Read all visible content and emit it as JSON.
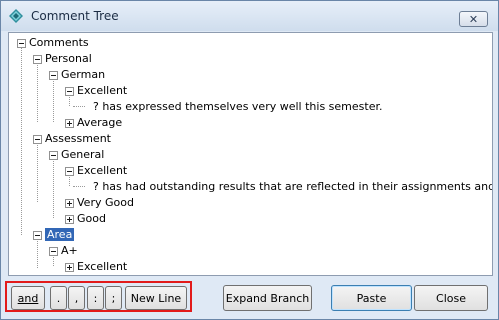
{
  "window": {
    "title": "Comment Tree",
    "close_glyph": "✕"
  },
  "tree": {
    "nodes": [
      {
        "label": "Comments"
      },
      {
        "label": "Personal"
      },
      {
        "label": "German"
      },
      {
        "label": "Excellent"
      },
      {
        "label": "? has expressed themselves very well this semester."
      },
      {
        "label": "Average"
      },
      {
        "label": "Assessment"
      },
      {
        "label": "General"
      },
      {
        "label": "Excellent"
      },
      {
        "label": "? has had outstanding results that are reflected in their assignments and test results."
      },
      {
        "label": "Very Good"
      },
      {
        "label": "Good"
      },
      {
        "label": "Area"
      },
      {
        "label": "A+"
      },
      {
        "label": "Excellent"
      }
    ]
  },
  "buttons": {
    "and": "and",
    "period": ".",
    "comma": ",",
    "colon": ":",
    "semicolon": ";",
    "new_line": "New Line",
    "expand_branch": "Expand Branch",
    "paste": "Paste",
    "close": "Close"
  },
  "colors": {
    "selection": "#3267b6",
    "highlight_border": "#e21b1b"
  }
}
